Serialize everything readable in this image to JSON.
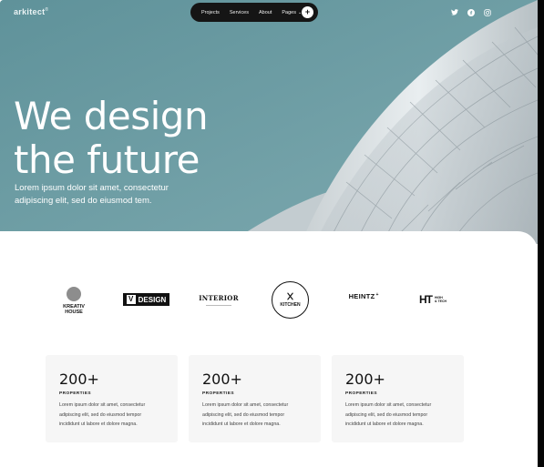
{
  "colors": {
    "hero_bg": "#6f9ea5",
    "nav_bg": "#151515",
    "card_bg": "#f6f6f6",
    "text_dark": "#111111"
  },
  "brand": {
    "name": "arkitect",
    "mark": "®"
  },
  "nav": {
    "links": [
      "Projects",
      "Services",
      "About",
      "Pages"
    ],
    "pages_caret": "⌄",
    "cta_icon": "plus-icon",
    "cta_glyph": "+"
  },
  "socials": [
    {
      "name": "twitter-icon"
    },
    {
      "name": "facebook-icon"
    },
    {
      "name": "instagram-icon"
    }
  ],
  "hero": {
    "headline_line1": "We design",
    "headline_line2": "the future",
    "subtext_line1": "Lorem ipsum dolor sit amet, consectetur",
    "subtext_line2": "adipiscing elit, sed do eiusmod tem."
  },
  "logos": {
    "kreativ": {
      "line1": "KREATIV",
      "line2": "HOUSE"
    },
    "vdesign": {
      "v": "V",
      "text": "DESIGN"
    },
    "interior": {
      "text": "INTERIOR"
    },
    "kitchen": {
      "text": "KITCHEN"
    },
    "heintz": {
      "text": "HEINTZ",
      "mark": "+"
    },
    "hightech": {
      "mark": "HT",
      "line1": "HIGH",
      "line2": "& TECH"
    }
  },
  "stats": [
    {
      "number": "200+",
      "label": "PROPERTIES",
      "line1": "Lorem ipsum dolor sit amet, consectetur",
      "line2": "adipiscing elit, sed do eiusmod tempor",
      "line3": "incididunt ut labore et dolore magna."
    },
    {
      "number": "200+",
      "label": "PROPERTIES",
      "line1": "Lorem ipsum dolor sit amet, consectetur",
      "line2": "adipiscing elit, sed do eiusmod tempor",
      "line3": "incididunt ut labore et dolore magna."
    },
    {
      "number": "200+",
      "label": "PROPERTIES",
      "line1": "Lorem ipsum dolor sit amet, consectetur",
      "line2": "adipiscing elit, sed do eiusmod tempor",
      "line3": "incididunt ut labore et dolore magna."
    }
  ]
}
